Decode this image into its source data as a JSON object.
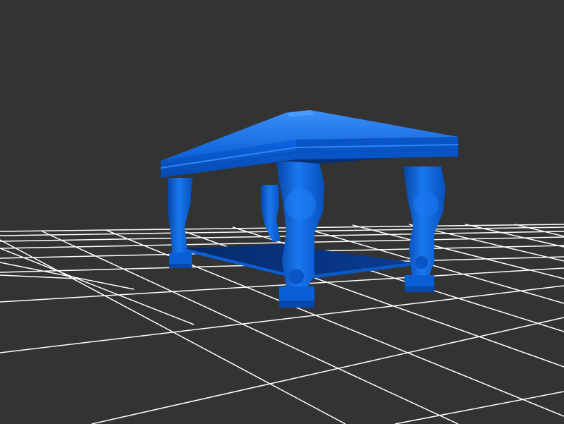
{
  "scene": {
    "background_color": "#333333",
    "grid_color": "#ffffff",
    "model_color": "#0a5fd6",
    "model_shadow_color": "#06378a",
    "model_highlight_color": "#2f86f5",
    "object": "carved-table"
  }
}
